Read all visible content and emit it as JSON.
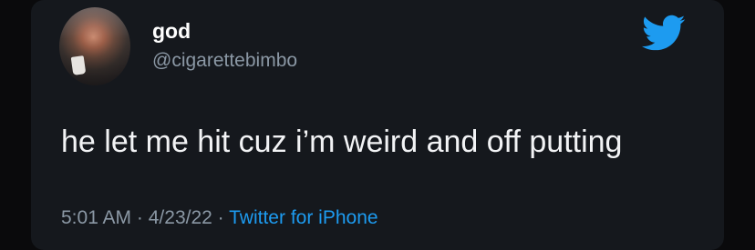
{
  "tweet": {
    "author": {
      "display_name": "god",
      "handle": "@cigarettebimbo",
      "avatar_icon": "profile-photo"
    },
    "text": "he let me hit cuz i’m weird and off putting",
    "meta": {
      "time": "5:01 AM",
      "separator": "·",
      "date": "4/23/22",
      "source": "Twitter for iPhone"
    },
    "logo_icon": "twitter-bird-icon"
  },
  "colors": {
    "background": "#15181d",
    "primary_text": "#f2f3f5",
    "secondary_text": "#8b98a5",
    "accent": "#1d9bf0"
  }
}
